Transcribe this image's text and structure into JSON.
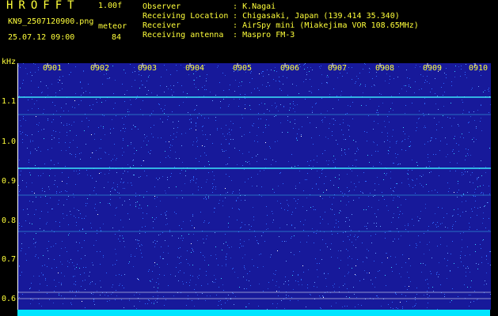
{
  "header": {
    "app_title": "HROFFT",
    "version": "1.00f",
    "filename": "KN9_2507120900.png",
    "meteor_label": "meteor",
    "datetime": "25.07.12 09:00",
    "meteor_count": "84"
  },
  "info": [
    {
      "key": "Observer",
      "value": "K.Nagai"
    },
    {
      "key": "Receiving Location",
      "value": "Chigasaki, Japan (139.414 35.340)"
    },
    {
      "key": "Receiver",
      "value": "AirSpy mini (Miakejima VOR 108.65MHz)"
    },
    {
      "key": "Receiving antenna",
      "value": "Maspro FM-3"
    }
  ],
  "separator": ":",
  "axis": {
    "y_unit": "kHz",
    "y_ticks": [
      "1.1",
      "1.0",
      "0.9",
      "0.8",
      "0.7",
      "0.6"
    ],
    "x_ticks": [
      "0901",
      "0902",
      "0903",
      "0904",
      "0905",
      "0906",
      "0907",
      "0908",
      "0909",
      "0910"
    ]
  },
  "colors": {
    "background": "#17199a",
    "text": "#ffff3a",
    "signal": "#3ff0ff",
    "strip": "#00e5ff"
  },
  "signals_khz": [
    1.11,
    0.93,
    1.066,
    0.862,
    0.77
  ]
}
